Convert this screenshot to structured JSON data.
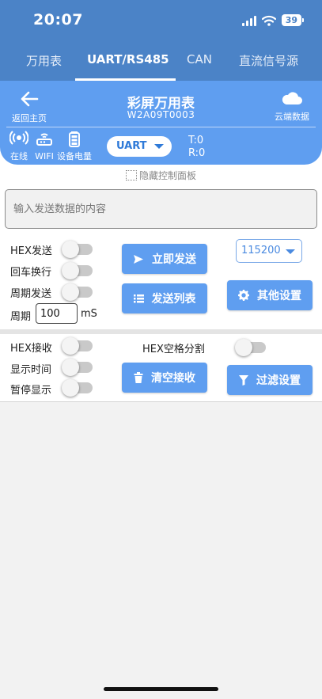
{
  "status": {
    "time": "20:07",
    "battery": "39"
  },
  "tabs": [
    {
      "label": "万用表"
    },
    {
      "label": "UART/RS485"
    },
    {
      "label": "CAN"
    },
    {
      "label": "直流信号源"
    }
  ],
  "header": {
    "back_label": "返回主页",
    "title": "彩屏万用表",
    "subtitle": "W2A09T0003",
    "cloud_label": "云端数据",
    "stats": {
      "online": "在线",
      "wifi": "WIFI",
      "battery": "设备电量"
    },
    "mode": "UART",
    "tx": "T:0",
    "rx": "R:0"
  },
  "hide_panel_label": "隐藏控制面板",
  "send_input": {
    "placeholder": "输入发送数据的内容"
  },
  "send_options": {
    "hex_send": "HEX发送",
    "crlf": "回车换行",
    "periodic": "周期发送",
    "period_label": "周期",
    "period_value": "100",
    "period_unit": "mS"
  },
  "buttons": {
    "send_now": "立即发送",
    "send_list": "发送列表",
    "other_settings": "其他设置",
    "clear_receive": "清空接收",
    "filter_settings": "过滤设置"
  },
  "baud_rate": "115200",
  "receive_options": {
    "hex_receive": "HEX接收",
    "show_time": "显示时间",
    "pause_display": "暂停显示",
    "hex_space_split": "HEX空格分割"
  },
  "colors": {
    "primary": "#5f9ef0",
    "tabbar": "#4b83c7"
  }
}
